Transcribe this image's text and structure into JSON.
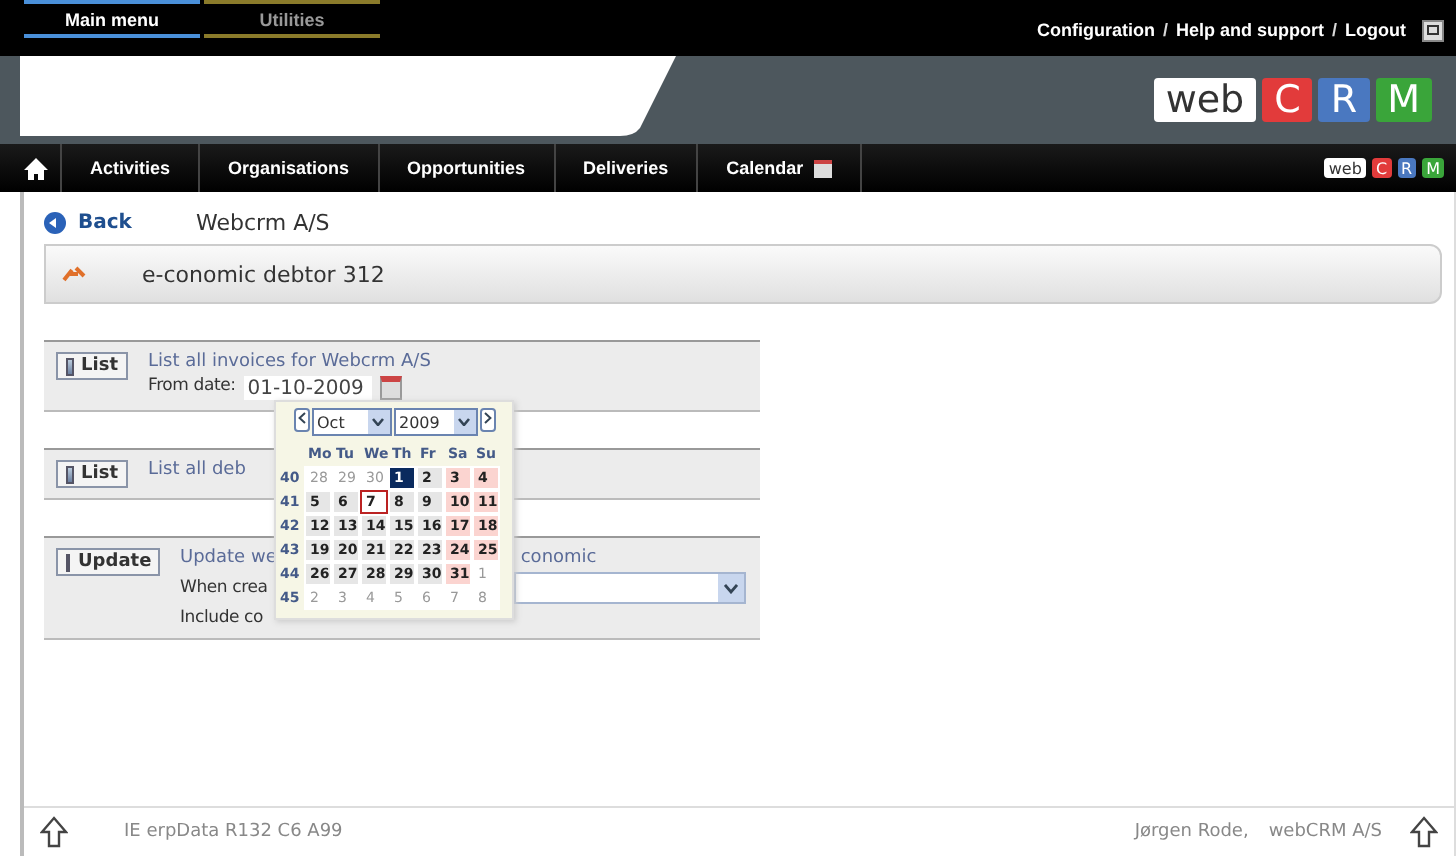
{
  "top_tabs": [
    {
      "label": "Main menu",
      "selected": true
    },
    {
      "label": "Utilities",
      "selected": false
    }
  ],
  "top_links": [
    {
      "kind": "link",
      "text": "Configuration"
    },
    {
      "kind": "separator",
      "text": "/"
    },
    {
      "kind": "link",
      "text": "Help and support"
    },
    {
      "kind": "separator",
      "text": "/"
    },
    {
      "kind": "link",
      "text": "Logout"
    }
  ],
  "logo": [
    {
      "text": "web",
      "color": "#ffffff"
    },
    {
      "text": "C",
      "color": "#e23b3b"
    },
    {
      "text": "R",
      "color": "#4a78c0"
    },
    {
      "text": "M",
      "color": "#3aa53a"
    }
  ],
  "nav": [
    {
      "label": "Activities"
    },
    {
      "label": "Organisations"
    },
    {
      "label": "Opportunities"
    },
    {
      "label": "Deliveries"
    },
    {
      "label": "Calendar",
      "has_icon": true
    }
  ],
  "nav_logo": [
    {
      "text": "web",
      "color": "#ffffff"
    },
    {
      "text": "C",
      "color": "#e23b3b"
    },
    {
      "text": "R",
      "color": "#4a78c0"
    },
    {
      "text": "M",
      "color": "#3aa53a"
    }
  ],
  "back": {
    "label": "Back",
    "company": "Webcrm A/S"
  },
  "title": "e-conomic debtor 312",
  "actions": [
    {
      "button": "List",
      "text_left": "List all invoices for Webcrm A/S",
      "from_label": "From date:",
      "from_value": "01-10-2009"
    },
    {
      "button": "List",
      "text_left": "List all deb"
    },
    {
      "button": "Update",
      "text_left": "Update we",
      "text_right": "conomic",
      "label_1": "When crea",
      "label_2": "Include co",
      "has_select": true
    }
  ],
  "calendar": {
    "month": "Oct",
    "year": "2009",
    "weekdays": [
      "Mo",
      "Tu",
      "We",
      "Th",
      "Fr",
      "Sa",
      "Su"
    ],
    "weeks": [
      {
        "number": "40",
        "days": [
          {
            "d": "28",
            "in_month": false,
            "selected": false,
            "today": false
          },
          {
            "d": "29",
            "in_month": false,
            "selected": false,
            "today": false
          },
          {
            "d": "30",
            "in_month": false,
            "selected": false,
            "today": false
          },
          {
            "d": "1",
            "in_month": true,
            "selected": true,
            "today": false
          },
          {
            "d": "2",
            "in_month": true,
            "selected": false,
            "today": false
          },
          {
            "d": "3",
            "in_month": true,
            "selected": false,
            "today": false
          },
          {
            "d": "4",
            "in_month": true,
            "selected": false,
            "today": false
          }
        ]
      },
      {
        "number": "41",
        "days": [
          {
            "d": "5",
            "in_month": true,
            "selected": false,
            "today": false
          },
          {
            "d": "6",
            "in_month": true,
            "selected": false,
            "today": false
          },
          {
            "d": "7",
            "in_month": true,
            "selected": false,
            "today": true
          },
          {
            "d": "8",
            "in_month": true,
            "selected": false,
            "today": false
          },
          {
            "d": "9",
            "in_month": true,
            "selected": false,
            "today": false
          },
          {
            "d": "10",
            "in_month": true,
            "selected": false,
            "today": false
          },
          {
            "d": "11",
            "in_month": true,
            "selected": false,
            "today": false
          }
        ]
      },
      {
        "number": "42",
        "days": [
          {
            "d": "12",
            "in_month": true,
            "selected": false,
            "today": false
          },
          {
            "d": "13",
            "in_month": true,
            "selected": false,
            "today": false
          },
          {
            "d": "14",
            "in_month": true,
            "selected": false,
            "today": false
          },
          {
            "d": "15",
            "in_month": true,
            "selected": false,
            "today": false
          },
          {
            "d": "16",
            "in_month": true,
            "selected": false,
            "today": false
          },
          {
            "d": "17",
            "in_month": true,
            "selected": false,
            "today": false
          },
          {
            "d": "18",
            "in_month": true,
            "selected": false,
            "today": false
          }
        ]
      },
      {
        "number": "43",
        "days": [
          {
            "d": "19",
            "in_month": true,
            "selected": false,
            "today": false
          },
          {
            "d": "20",
            "in_month": true,
            "selected": false,
            "today": false
          },
          {
            "d": "21",
            "in_month": true,
            "selected": false,
            "today": false
          },
          {
            "d": "22",
            "in_month": true,
            "selected": false,
            "today": false
          },
          {
            "d": "23",
            "in_month": true,
            "selected": false,
            "today": false
          },
          {
            "d": "24",
            "in_month": true,
            "selected": false,
            "today": false
          },
          {
            "d": "25",
            "in_month": true,
            "selected": false,
            "today": false
          }
        ]
      },
      {
        "number": "44",
        "days": [
          {
            "d": "26",
            "in_month": true,
            "selected": false,
            "today": false
          },
          {
            "d": "27",
            "in_month": true,
            "selected": false,
            "today": false
          },
          {
            "d": "28",
            "in_month": true,
            "selected": false,
            "today": false
          },
          {
            "d": "29",
            "in_month": true,
            "selected": false,
            "today": false
          },
          {
            "d": "30",
            "in_month": true,
            "selected": false,
            "today": false
          },
          {
            "d": "31",
            "in_month": true,
            "selected": false,
            "today": false
          },
          {
            "d": "1",
            "in_month": false,
            "selected": false,
            "today": false
          }
        ]
      },
      {
        "number": "45",
        "days": [
          {
            "d": "2",
            "in_month": false,
            "selected": false,
            "today": false
          },
          {
            "d": "3",
            "in_month": false,
            "selected": false,
            "today": false
          },
          {
            "d": "4",
            "in_month": false,
            "selected": false,
            "today": false
          },
          {
            "d": "5",
            "in_month": false,
            "selected": false,
            "today": false
          },
          {
            "d": "6",
            "in_month": false,
            "selected": false,
            "today": false
          },
          {
            "d": "7",
            "in_month": false,
            "selected": false,
            "today": false
          },
          {
            "d": "8",
            "in_month": false,
            "selected": false,
            "today": false
          }
        ]
      }
    ]
  },
  "status_bar": {
    "left": "IE erpData R132 C6 A99",
    "user": "Jørgen Rode,",
    "company": "webCRM A/S"
  }
}
